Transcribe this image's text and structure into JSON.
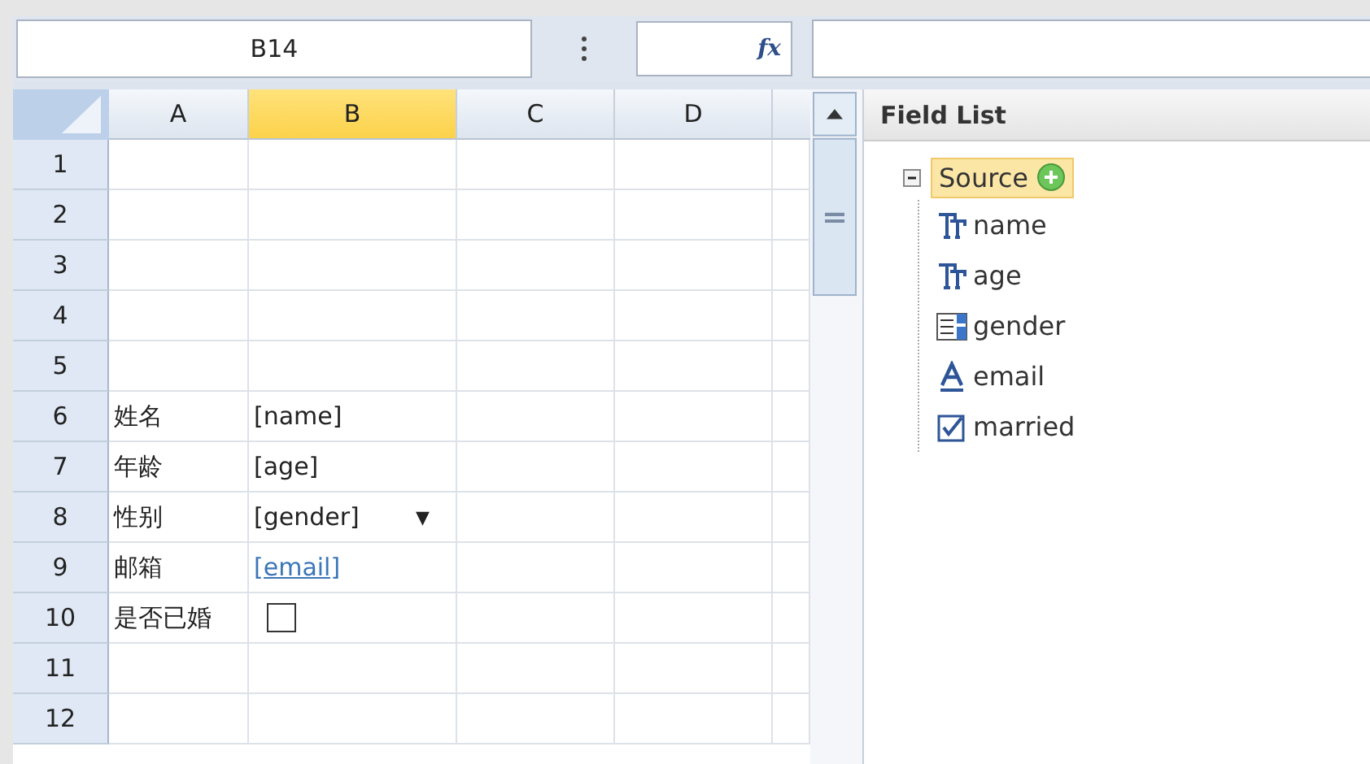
{
  "formula_bar": {
    "name_box": "B14",
    "function_label": "fx"
  },
  "columns": [
    {
      "label": "A",
      "selected": false
    },
    {
      "label": "B",
      "selected": true
    },
    {
      "label": "C",
      "selected": false
    },
    {
      "label": "D",
      "selected": false
    }
  ],
  "rows": [
    {
      "number": "1",
      "cells": []
    },
    {
      "number": "2",
      "cells": []
    },
    {
      "number": "3",
      "cells": []
    },
    {
      "number": "4",
      "cells": []
    },
    {
      "number": "5",
      "cells": []
    },
    {
      "number": "6",
      "cells": [
        {
          "kind": "text",
          "text": "姓名"
        },
        {
          "kind": "text",
          "text": "[name]"
        }
      ]
    },
    {
      "number": "7",
      "cells": [
        {
          "kind": "text",
          "text": "年龄"
        },
        {
          "kind": "text",
          "text": "[age]"
        }
      ]
    },
    {
      "number": "8",
      "cells": [
        {
          "kind": "text",
          "text": "性别"
        },
        {
          "kind": "dropdown",
          "text": "[gender]",
          "arrow": "▼"
        }
      ]
    },
    {
      "number": "9",
      "cells": [
        {
          "kind": "text",
          "text": "邮箱"
        },
        {
          "kind": "link",
          "text": "[email]"
        }
      ]
    },
    {
      "number": "10",
      "cells": [
        {
          "kind": "text",
          "text": "是否已婚"
        },
        {
          "kind": "checkbox",
          "checked": false
        }
      ]
    },
    {
      "number": "11",
      "cells": []
    },
    {
      "number": "12",
      "cells": []
    }
  ],
  "field_list": {
    "title": "Field List",
    "root": {
      "label": "Source",
      "expanded": true,
      "selected": true,
      "children": [
        {
          "label": "name",
          "kind": "text"
        },
        {
          "label": "age",
          "kind": "text"
        },
        {
          "label": "gender",
          "kind": "list"
        },
        {
          "label": "email",
          "kind": "hyperlink"
        },
        {
          "label": "married",
          "kind": "checkbox"
        }
      ]
    }
  }
}
